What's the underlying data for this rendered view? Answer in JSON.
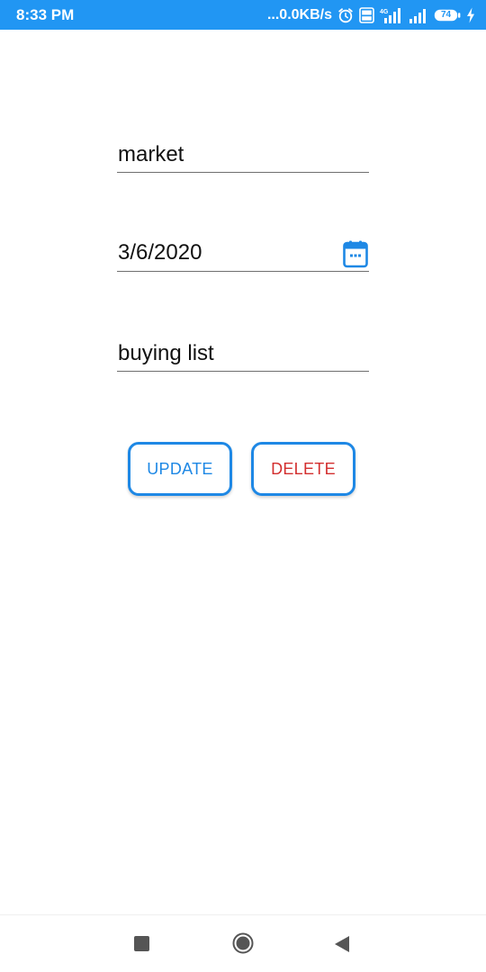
{
  "status_bar": {
    "time": "8:33 PM",
    "net_speed": "...0.0KB/s",
    "battery_percent": "74",
    "network_label": "4G",
    "icons": [
      "alarm-icon",
      "volte-icon",
      "signal-4g-icon",
      "signal-icon",
      "battery-icon",
      "charging-icon"
    ],
    "background_color": "#2196f3"
  },
  "form": {
    "title_value": "market",
    "date_value": "3/6/2020",
    "description_value": "buying list",
    "date_picker_icon": "calendar-icon"
  },
  "actions": {
    "update_label": "UPDATE",
    "delete_label": "DELETE",
    "update_color": "#1e88e5",
    "delete_color": "#d32f2f",
    "border_color": "#1e88e5"
  },
  "navigation": {
    "icons": [
      "recent-apps-icon",
      "home-icon",
      "back-icon"
    ]
  }
}
